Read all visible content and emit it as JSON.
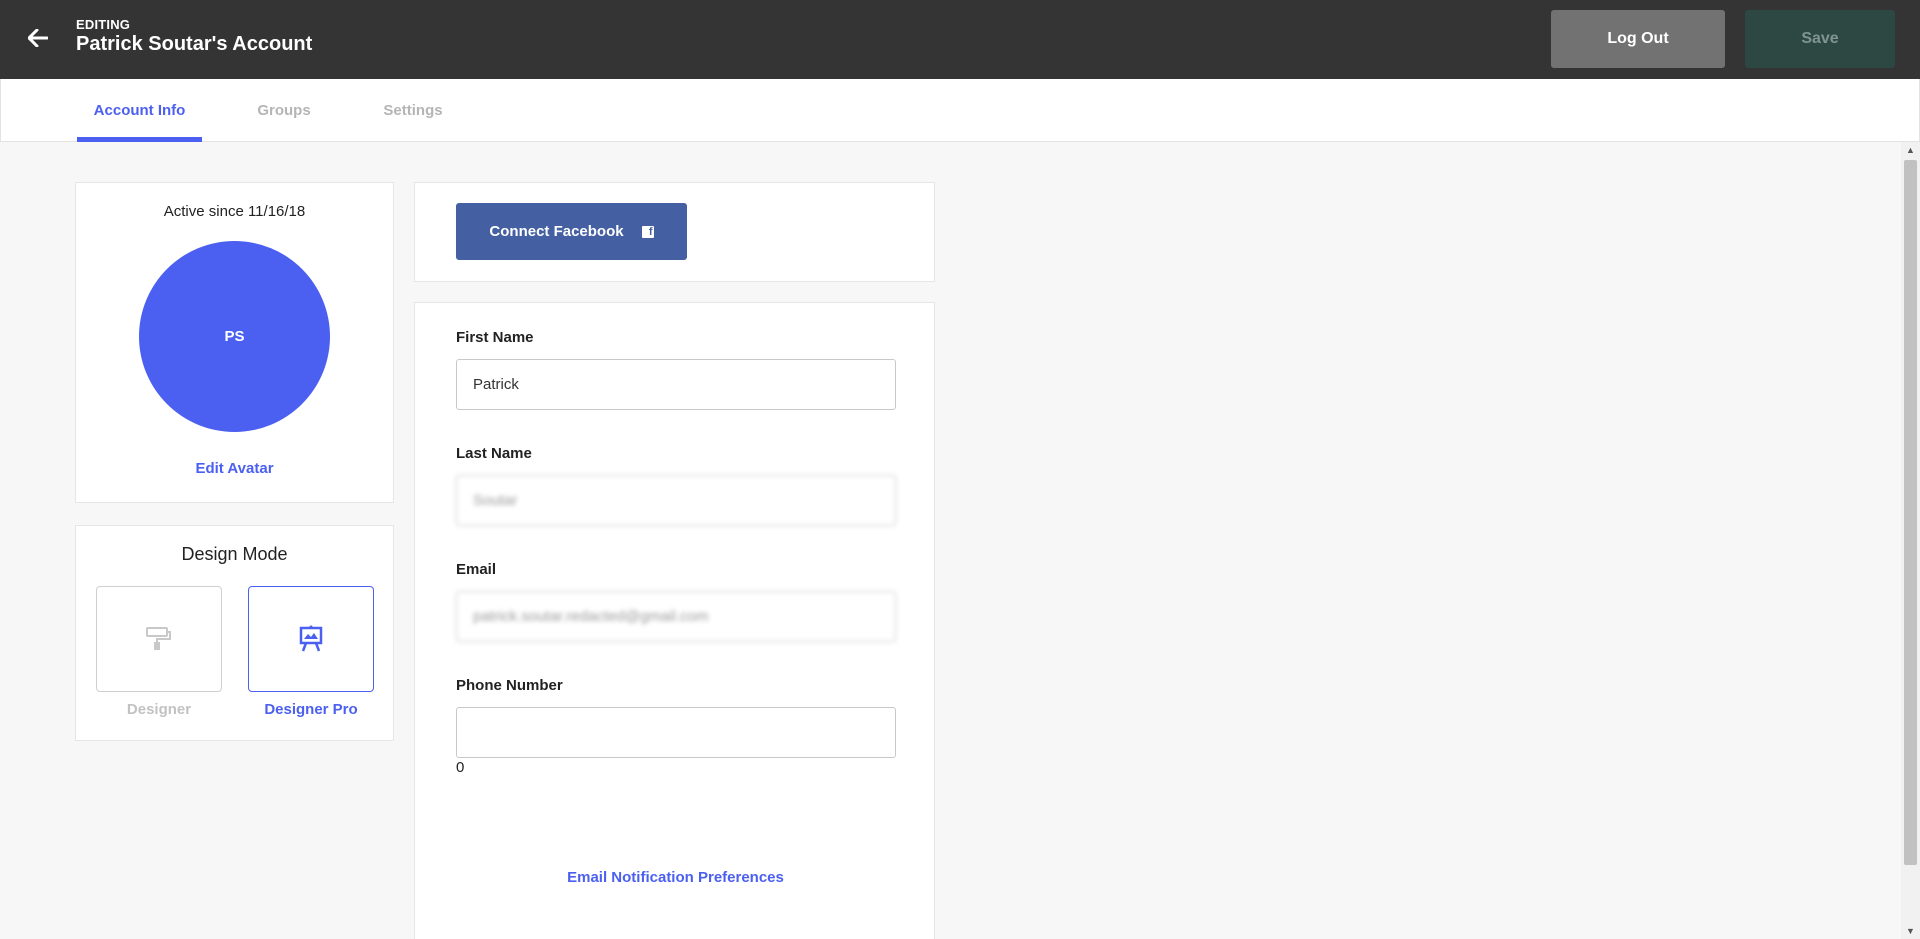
{
  "header": {
    "mode_label": "EDITING",
    "title": "Patrick Soutar's Account",
    "logout_label": "Log Out",
    "save_label": "Save",
    "back_icon": "arrow-left-icon"
  },
  "tabs": [
    {
      "label": "Account Info",
      "active": true
    },
    {
      "label": "Groups",
      "active": false
    },
    {
      "label": "Settings",
      "active": false
    }
  ],
  "profile": {
    "active_since": "Active since 11/16/18",
    "initials": "PS",
    "edit_avatar_label": "Edit Avatar",
    "avatar_color": "#4b60f0"
  },
  "design_mode": {
    "title": "Design Mode",
    "options": [
      {
        "label": "Designer",
        "icon": "paint-roller-icon",
        "selected": false
      },
      {
        "label": "Designer Pro",
        "icon": "easel-icon",
        "selected": true
      }
    ]
  },
  "facebook": {
    "connect_label": "Connect Facebook",
    "icon": "facebook-icon",
    "color": "#4460a3"
  },
  "form": {
    "first_name": {
      "label": "First Name",
      "value": "Patrick"
    },
    "last_name": {
      "label": "Last Name",
      "value": "Soutar"
    },
    "email": {
      "label": "Email",
      "value": "patrick.soutar.redacted@gmail.com"
    },
    "phone": {
      "label": "Phone Number",
      "value": "",
      "counter": "0"
    },
    "notifications_link": "Email Notification Preferences"
  },
  "colors": {
    "accent": "#4b60f0",
    "header_bg": "#343434",
    "logout_bg": "#727272",
    "save_bg": "#2d4742"
  }
}
